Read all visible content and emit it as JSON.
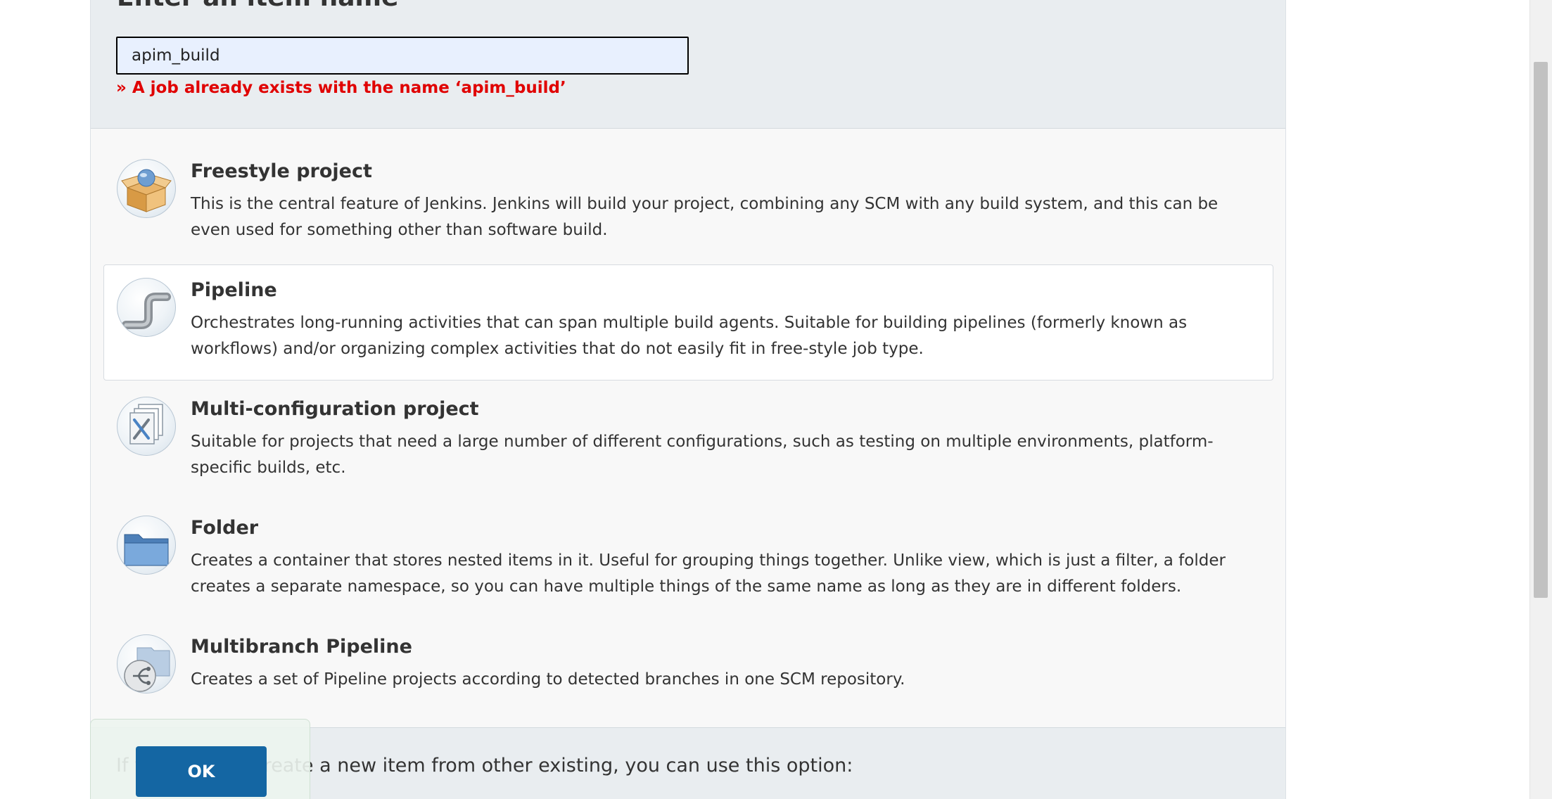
{
  "header": {
    "title": "Enter an item name",
    "item_name_value": "apim_build",
    "error_message": "» A job already exists with the name ‘apim_build’"
  },
  "item_types": [
    {
      "title": "Freestyle project",
      "description": "This is the central feature of Jenkins. Jenkins will build your project, combining any SCM with any build system, and this can be even used for something other than software build.",
      "icon": "freestyle-project-icon"
    },
    {
      "title": "Pipeline",
      "description": "Orchestrates long-running activities that can span multiple build agents. Suitable for building pipelines (formerly known as workflows) and/or organizing complex activities that do not easily fit in free-style job type.",
      "icon": "pipeline-icon",
      "selected": true
    },
    {
      "title": "Multi-configuration project",
      "description": "Suitable for projects that need a large number of different configurations, such as testing on multiple environments, platform-specific builds, etc.",
      "icon": "multi-configuration-project-icon"
    },
    {
      "title": "Folder",
      "description": "Creates a container that stores nested items in it. Useful for grouping things together. Unlike view, which is just a filter, a folder creates a separate namespace, so you can have multiple things of the same name as long as they are in different folders.",
      "icon": "folder-icon"
    },
    {
      "title": "Multibranch Pipeline",
      "description": "Creates a set of Pipeline projects according to detected branches in one SCM repository.",
      "icon": "multibranch-pipeline-icon"
    }
  ],
  "copy_section": {
    "text": "If you want to create a new item from other existing, you can use this option:"
  },
  "footer": {
    "ok_label": "OK"
  },
  "colors": {
    "accent": "#1466a3",
    "error": "#e00000",
    "header_bg": "#e9edf0",
    "panel_bg": "#f8f8f8"
  }
}
